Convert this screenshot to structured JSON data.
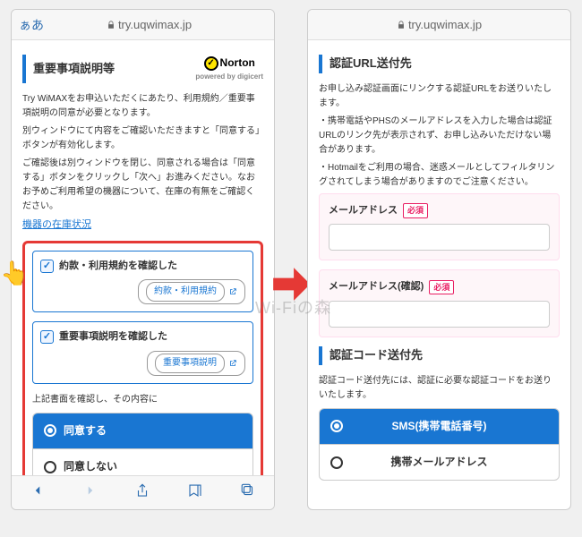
{
  "url": "try.uqwimax.jp",
  "aa": "ぁあ",
  "p1": {
    "title": "重要事項説明等",
    "norton": "Norton",
    "nortonSub": "powered by digicert",
    "para1": "Try WiMAXをお申込いただくにあたり、利用規約／重要事項説明の同意が必要となります。",
    "para2": "別ウィンドウにて内容をご確認いただきますと「同意する」ボタンが有効化します。",
    "para3": "ご確認後は別ウィンドウを閉じ、同意される場合は「同意する」ボタンをクリックし「次へ」お進みください。なおお予めご利用希望の機器について、在庫の有無をご確認ください。",
    "link": "機器の在庫状況",
    "chk1": "約款・利用規約を確認した",
    "btn1": "約款・利用規約",
    "chk2": "重要事項説明を確認した",
    "btn2": "重要事項説明",
    "note": "上記書面を確認し、その内容に",
    "agree": "同意する",
    "disagree": "同意しない"
  },
  "p2": {
    "h1": "認証URL送付先",
    "p1": "お申し込み認証画面にリンクする認証URLをお送りいたします。",
    "p2": "・携帯電話やPHSのメールアドレスを入力した場合は認証URLのリンク先が表示されず、お申し込みいただけない場合があります。",
    "p3": "・Hotmailをご利用の場合、迷惑メールとしてフィルタリングされてしまう場合がありますのでご注意ください。",
    "lbl1": "メールアドレス",
    "lbl2": "メールアドレス(確認)",
    "req": "必須",
    "h2": "認証コード送付先",
    "p4": "認証コード送付先には、認証に必要な認証コードをお送りいたします。",
    "opt1": "SMS(携帯電話番号)",
    "opt2": "携帯メールアドレス"
  },
  "watermark": "Wi-Fiの森"
}
